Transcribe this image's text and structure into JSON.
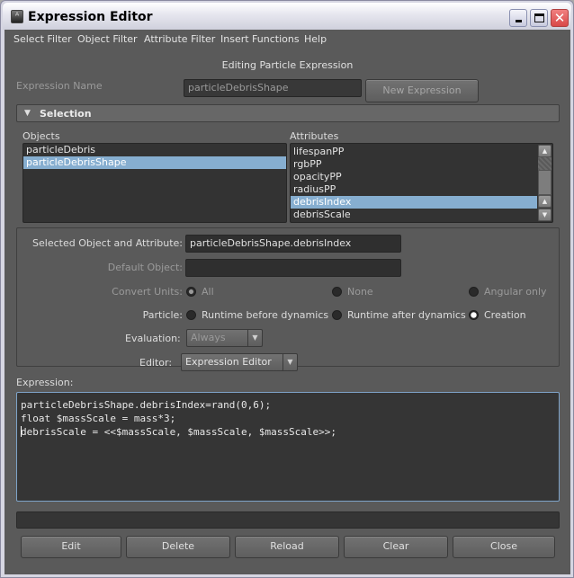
{
  "window": {
    "title": "Expression Editor",
    "controls": {
      "minimize": "_",
      "maximize": "□",
      "close": "✕"
    }
  },
  "menubar": [
    "Select Filter",
    "Object Filter",
    "Attribute Filter",
    "Insert Functions",
    "Help"
  ],
  "heading": "Editing Particle Expression",
  "expression_name": {
    "label": "Expression Name",
    "value": "particleDebrisShape",
    "new_button": "New Expression"
  },
  "selection": {
    "title": "Selection",
    "objects_label": "Objects",
    "objects": [
      {
        "label": "particleDebris",
        "selected": false
      },
      {
        "label": "particleDebrisShape",
        "selected": true
      }
    ],
    "attributes_label": "Attributes",
    "attributes": [
      {
        "label": "lifespanPP",
        "selected": false
      },
      {
        "label": "rgbPP",
        "selected": false
      },
      {
        "label": "opacityPP",
        "selected": false
      },
      {
        "label": "radiusPP",
        "selected": false
      },
      {
        "label": "debrisIndex",
        "selected": true
      },
      {
        "label": "debrisScale",
        "selected": false
      }
    ]
  },
  "settings": {
    "selected_label": "Selected Object and Attribute:",
    "selected_value": "particleDebrisShape.debrisIndex",
    "default_object_label": "Default Object:",
    "default_object_value": "",
    "convert_units_label": "Convert Units:",
    "convert_units_options": [
      "All",
      "None",
      "Angular only"
    ],
    "convert_units_selected": "All",
    "particle_label": "Particle:",
    "particle_options": [
      "Runtime before dynamics",
      "Runtime after dynamics",
      "Creation"
    ],
    "particle_selected": "Creation",
    "evaluation_label": "Evaluation:",
    "evaluation_value": "Always"
  },
  "editor": {
    "label": "Editor:",
    "value": "Expression Editor"
  },
  "expression": {
    "label": "Expression:",
    "lines": [
      "particleDebrisShape.debrisIndex=rand(0,6);",
      "float $massScale = mass*3;",
      "debrisScale = <<$massScale, $massScale, $massScale>>;"
    ]
  },
  "status_text": "",
  "buttons": [
    "Edit",
    "Delete",
    "Reload",
    "Clear",
    "Close"
  ]
}
